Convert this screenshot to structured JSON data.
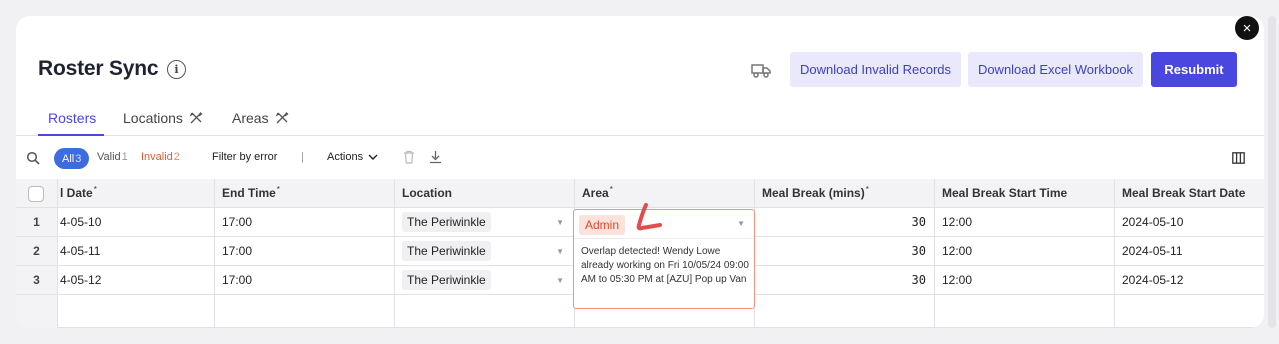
{
  "modal": {
    "title": "Roster Sync",
    "close_label": "×",
    "buttons": {
      "download_invalid": "Download Invalid Records",
      "download_excel": "Download Excel Workbook",
      "resubmit": "Resubmit"
    }
  },
  "tabs": [
    {
      "label": "Rosters",
      "active": true
    },
    {
      "label": "Locations",
      "icon": "tools-icon"
    },
    {
      "label": "Areas",
      "icon": "tools-icon"
    }
  ],
  "toolbar": {
    "all_label": "All",
    "all_count": "3",
    "valid_label": "Valid",
    "valid_count": "1",
    "invalid_label": "Invalid",
    "invalid_count": "2",
    "filter_label": "Filter by error",
    "separator": "|",
    "actions_label": "Actions"
  },
  "columns": [
    {
      "label": "l Date",
      "required": true
    },
    {
      "label": "End Time",
      "required": true
    },
    {
      "label": "Location",
      "required": false
    },
    {
      "label": "Area",
      "required": true
    },
    {
      "label": "Meal Break (mins)",
      "required": true
    },
    {
      "label": "Meal Break Start Time",
      "required": false
    },
    {
      "label": "Meal Break Start Date",
      "required": false
    }
  ],
  "rows": [
    {
      "num": "1",
      "date": "4-05-10",
      "end_time": "17:00",
      "location": "The Periwinkle",
      "meal_mins": "30",
      "meal_start_time": "12:00",
      "meal_start_date": "2024-05-10"
    },
    {
      "num": "2",
      "date": "4-05-11",
      "end_time": "17:00",
      "location": "The Periwinkle",
      "meal_mins": "30",
      "meal_start_time": "12:00",
      "meal_start_date": "2024-05-11"
    },
    {
      "num": "3",
      "date": "4-05-12",
      "end_time": "17:00",
      "location": "The Periwinkle",
      "meal_mins": "30",
      "meal_start_time": "12:00",
      "meal_start_date": "2024-05-12"
    }
  ],
  "area_editor": {
    "value": "Admin",
    "error": "Overlap detected! Wendy Lowe already working on Fri 10/05/24 09:00 AM to 05:30 PM at [AZU] Pop up Van"
  },
  "colors": {
    "primary": "#4a46e0",
    "secondary_bg": "#e9e9fb",
    "error": "#e0592f",
    "all_chip": "#3d6be0"
  }
}
